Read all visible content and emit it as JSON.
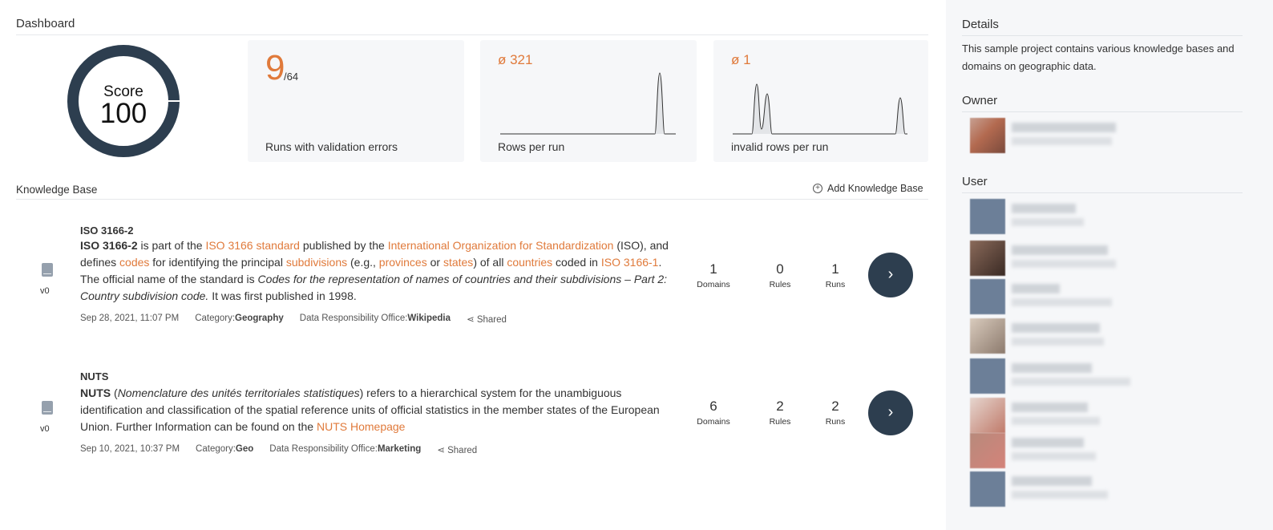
{
  "dashboard": {
    "title": "Dashboard"
  },
  "score": {
    "label": "Score",
    "value": "100"
  },
  "cards": {
    "runs": {
      "value": "9",
      "total": "/64",
      "caption": "Runs with validation errors"
    },
    "rows": {
      "avg": "ø 321",
      "caption": "Rows per run"
    },
    "invalid": {
      "avg": "ø 1",
      "caption": "invalid rows per run"
    }
  },
  "kb_section": {
    "title": "Knowledge Base",
    "add_label": "Add Knowledge Base"
  },
  "knowledge_bases": [
    {
      "title": "ISO 3166-2",
      "version": "v0",
      "desc": {
        "b": "ISO 3166-2",
        "t1": " is part of the ",
        "a1": "ISO 3166 standard",
        "t2": " published by the ",
        "a2": "International Organization for Standardization",
        "t3": " (ISO), and defines ",
        "a3": "codes",
        "t4": " for identifying the principal ",
        "a4": "subdivisions",
        "t5": " (e.g., ",
        "a5": "provinces",
        "t6": " or ",
        "a6": "states",
        "t7": ") of all ",
        "a7": "countries",
        "t8": " coded in ",
        "a8": "ISO 3166-1",
        "t9": ". The official name of the standard is ",
        "i1": "Codes for the representation of names of countries and their subdivisions – Part 2: Country subdivision code.",
        "t10": " It was first published in 1998."
      },
      "date": "Sep 28, 2021, 11:07 PM",
      "category_label": "Category:",
      "category": "Geography",
      "office_label": "Data Responsibility Office:",
      "office": "Wikipedia",
      "shared": "Shared",
      "domains": "1",
      "domains_label": "Domains",
      "rules": "0",
      "rules_label": "Rules",
      "runs": "1",
      "runs_label": "Runs"
    },
    {
      "title": "NUTS",
      "version": "v0",
      "desc": {
        "b": "NUTS",
        "t1": " (",
        "i1": "Nomenclature des unités territoriales statistiques",
        "t2": ") refers to a hierarchical system for the unambiguous identification and classification of the spatial reference units of official statistics in the member states of the European Union. Further Information can be found on the ",
        "a1": "NUTS Homepage"
      },
      "date": "Sep 10, 2021, 10:37 PM",
      "category_label": "Category:",
      "category": "Geo",
      "office_label": "Data Responsibility Office:",
      "office": "Marketing",
      "shared": "Shared",
      "domains": "6",
      "domains_label": "Domains",
      "rules": "2",
      "rules_label": "Rules",
      "runs": "2",
      "runs_label": "Runs"
    }
  ],
  "sidebar": {
    "details_title": "Details",
    "details_text": "This sample project contains various knowledge bases and domains on geographic data.",
    "owner_title": "Owner",
    "user_title": "User"
  }
}
